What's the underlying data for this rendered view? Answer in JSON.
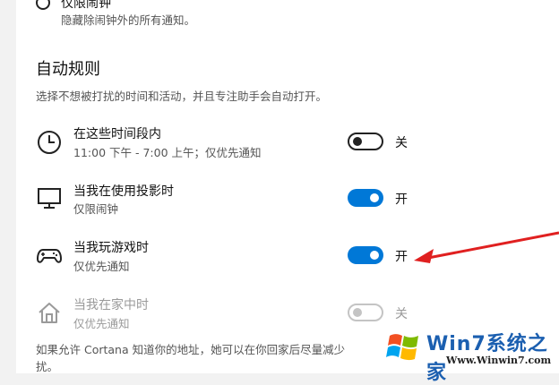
{
  "top_option": {
    "label": "仅限闹钟",
    "description": "隐藏除闹钟外的所有通知。"
  },
  "automatic_rules": {
    "title": "自动规则",
    "description": "选择不想被打扰的时间和活动，并且专注助手会自动打开。",
    "rules": [
      {
        "title": "在这些时间段内",
        "subtitle": "11:00 下午 - 7:00 上午；仅优先通知",
        "icon": "clock-icon",
        "state": "off",
        "state_label": "关"
      },
      {
        "title": "当我在使用投影时",
        "subtitle": "仅限闹钟",
        "icon": "monitor-icon",
        "state": "on",
        "state_label": "开"
      },
      {
        "title": "当我玩游戏时",
        "subtitle": "仅优先通知",
        "icon": "gamepad-icon",
        "state": "on",
        "state_label": "开"
      },
      {
        "title": "当我在家中时",
        "subtitle": "仅优先通知",
        "icon": "home-icon",
        "state": "disabled",
        "state_label": "关"
      }
    ]
  },
  "footer": {
    "line1": "如果允许 Cortana 知道你的地址，她可以在你回家后尽量减少",
    "line2": "扰。"
  },
  "watermark": {
    "brand": "Win7系统之家",
    "url": "Www.Winwin7.com"
  },
  "colors": {
    "accent": "#0078d7",
    "arrow": "#e02020",
    "disabled": "#9a9a9a"
  }
}
